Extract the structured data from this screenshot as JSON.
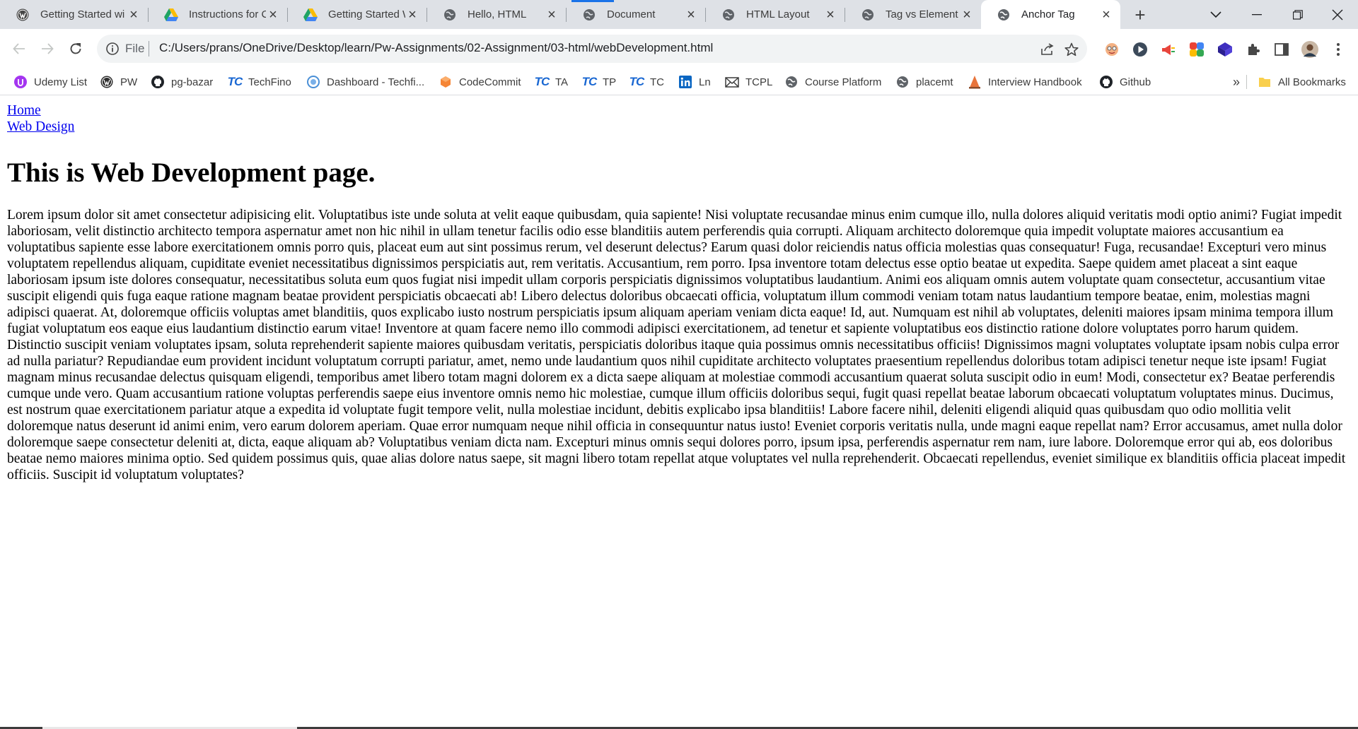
{
  "tabs": [
    {
      "title": "Getting Started wi",
      "icon": "wordpress-icon"
    },
    {
      "title": "Instructions for Cr",
      "icon": "google-drive-icon"
    },
    {
      "title": "Getting Started Wi",
      "icon": "google-drive-icon"
    },
    {
      "title": "Hello, HTML",
      "icon": "globe-icon"
    },
    {
      "title": "Document",
      "icon": "globe-icon"
    },
    {
      "title": "HTML Layout",
      "icon": "globe-icon"
    },
    {
      "title": "Tag vs Element",
      "icon": "globe-icon"
    },
    {
      "title": "Anchor Tag",
      "icon": "globe-icon",
      "active": true
    }
  ],
  "toolbar": {
    "scheme": "File",
    "url": "C:/Users/prans/OneDrive/Desktop/learn/Pw-Assignments/02-Assignment/03-html/webDevelopment.html"
  },
  "bookmarks": [
    {
      "label": "Udemy List",
      "icon": "udemy-icon"
    },
    {
      "label": "PW",
      "icon": "pw-icon"
    },
    {
      "label": "pg-bazar",
      "icon": "github-icon"
    },
    {
      "label": "TechFino",
      "icon": "tc-icon"
    },
    {
      "label": "Dashboard - Techfi...",
      "icon": "dashboard-icon"
    },
    {
      "label": "CodeCommit",
      "icon": "codecommit-icon"
    },
    {
      "label": "TA",
      "icon": "tc-icon"
    },
    {
      "label": "TP",
      "icon": "tc-icon"
    },
    {
      "label": "TC",
      "icon": "tc-icon"
    },
    {
      "label": "Ln",
      "icon": "linkedin-icon"
    },
    {
      "label": "TCPL",
      "icon": "mail-icon"
    },
    {
      "label": "Course Platform",
      "icon": "globe-icon"
    },
    {
      "label": "placemt",
      "icon": "globe-icon"
    },
    {
      "label": "Interview Handbook",
      "icon": "handbook-icon"
    },
    {
      "label": "Github",
      "icon": "github-icon"
    }
  ],
  "bookmarks_overflow": "»",
  "all_bookmarks": "All Bookmarks",
  "page": {
    "links": [
      "Home",
      "Web Design"
    ],
    "heading": "This is Web Development page.",
    "paragraph": "Lorem ipsum dolor sit amet consectetur adipisicing elit. Voluptatibus iste unde soluta at velit eaque quibusdam, quia sapiente! Nisi voluptate recusandae minus enim cumque illo, nulla dolores aliquid veritatis modi optio animi? Fugiat impedit laboriosam, velit distinctio architecto tempora aspernatur amet non hic nihil in ullam tenetur facilis odio esse blanditiis autem perferendis quia corrupti. Aliquam architecto doloremque quia impedit voluptate maiores accusantium ea voluptatibus sapiente esse labore exercitationem omnis porro quis, placeat eum aut sint possimus rerum, vel deserunt delectus? Earum quasi dolor reiciendis natus officia molestias quas consequatur! Fuga, recusandae! Excepturi vero minus voluptatem repellendus aliquam, cupiditate eveniet necessitatibus dignissimos perspiciatis aut, rem veritatis. Accusantium, rem porro. Ipsa inventore totam delectus esse optio beatae ut expedita. Saepe quidem amet placeat a sint eaque laboriosam ipsum iste dolores consequatur, necessitatibus soluta eum quos fugiat nisi impedit ullam corporis perspiciatis dignissimos voluptatibus laudantium. Animi eos aliquam omnis autem voluptate quam consectetur, accusantium vitae suscipit eligendi quis fuga eaque ratione magnam beatae provident perspiciatis obcaecati ab! Libero delectus doloribus obcaecati officia, voluptatum illum commodi veniam totam natus laudantium tempore beatae, enim, molestias magni adipisci quaerat. At, doloremque officiis voluptas amet blanditiis, quos explicabo iusto nostrum perspiciatis ipsum aliquam aperiam veniam dicta eaque! Id, aut. Numquam est nihil ab voluptates, deleniti maiores ipsam minima tempora illum fugiat voluptatum eos eaque eius laudantium distinctio earum vitae! Inventore at quam facere nemo illo commodi adipisci exercitationem, ad tenetur et sapiente voluptatibus eos distinctio ratione dolore voluptates porro harum quidem. Distinctio suscipit veniam voluptates ipsam, soluta reprehenderit sapiente maiores quibusdam veritatis, perspiciatis doloribus itaque quia possimus omnis necessitatibus officiis! Dignissimos magni voluptates voluptate ipsam nobis culpa error ad nulla pariatur? Repudiandae eum provident incidunt voluptatum corrupti pariatur, amet, nemo unde laudantium quos nihil cupiditate architecto voluptates praesentium repellendus doloribus totam adipisci tenetur neque iste ipsam! Fugiat magnam minus recusandae delectus quisquam eligendi, temporibus amet libero totam magni dolorem ex a dicta saepe aliquam at molestiae commodi accusantium quaerat soluta suscipit odio in eum! Modi, consectetur ex? Beatae perferendis cumque unde vero. Quam accusantium ratione voluptas perferendis saepe eius inventore omnis nemo hic molestiae, cumque illum officiis doloribus sequi, fugit quasi repellat beatae laborum obcaecati voluptatum voluptates minus. Ducimus, est nostrum quae exercitationem pariatur atque a expedita id voluptate fugit tempore velit, nulla molestiae incidunt, debitis explicabo ipsa blanditiis! Labore facere nihil, deleniti eligendi aliquid quas quibusdam quo odio mollitia velit doloremque natus deserunt id animi enim, vero earum dolorem aperiam. Quae error numquam neque nihil officia in consequuntur natus iusto! Eveniet corporis veritatis nulla, unde magni eaque repellat nam? Error accusamus, amet nulla dolor doloremque saepe consectetur deleniti at, dicta, eaque aliquam ab? Voluptatibus veniam dicta nam. Excepturi minus omnis sequi dolores porro, ipsum ipsa, perferendis aspernatur rem nam, iure labore. Doloremque error qui ab, eos doloribus beatae nemo maiores minima optio. Sed quidem possimus quis, quae alias dolore natus saepe, sit magni libero totam repellat atque voluptates vel nulla reprehenderit. Obcaecati repellendus, eveniet similique ex blanditiis officia placeat impedit officiis. Suscipit id voluptatum voluptates?"
  },
  "colors": {
    "tabstrip_bg": "#dee1e6",
    "link": "#0000ee",
    "accent": "#1a73e8"
  }
}
